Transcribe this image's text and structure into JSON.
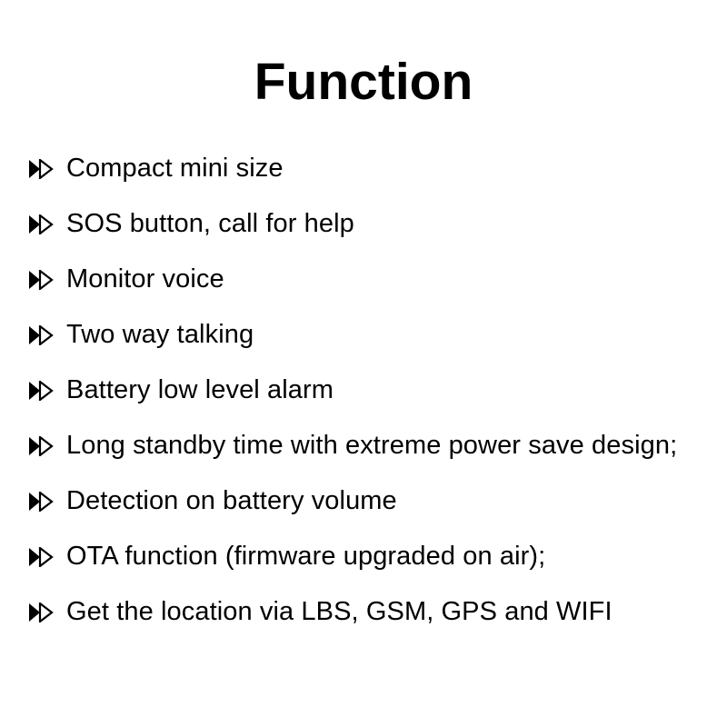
{
  "slide": {
    "background_color": "#ffffff",
    "text_color": "#000000",
    "title": "Function",
    "bullet_icon": "double-triangle-bullet-icon",
    "features": [
      {
        "label": "Compact mini size"
      },
      {
        "label": "SOS button, call for help"
      },
      {
        "label": "Monitor voice"
      },
      {
        "label": "Two way talking"
      },
      {
        "label": "Battery low level alarm"
      },
      {
        "label": "Long standby time with extreme power save design;"
      },
      {
        "label": "Detection on battery volume"
      },
      {
        "label": "OTA function (firmware upgraded on air);"
      },
      {
        "label": "Get the location via LBS, GSM, GPS and WIFI"
      }
    ]
  }
}
